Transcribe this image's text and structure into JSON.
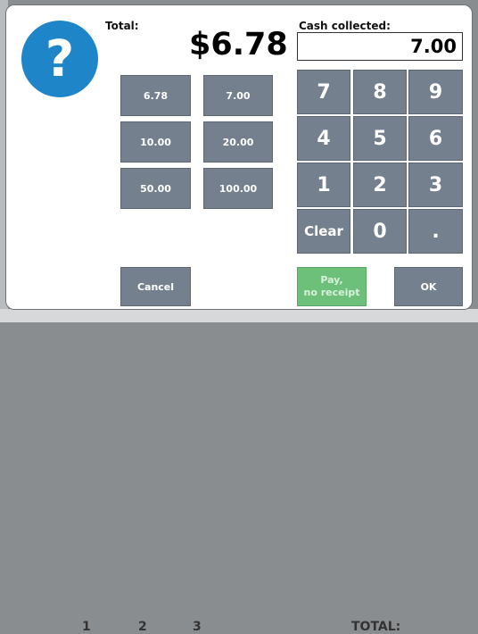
{
  "background": {
    "bottom_digits": [
      "1",
      "2",
      "3"
    ],
    "bottom_total_label": "TOTAL:"
  },
  "dialog": {
    "help_icon_glyph": "?",
    "total_label": "Total:",
    "total_value": "$6.78",
    "cash_label": "Cash collected:",
    "cash_value": "7.00"
  },
  "quick_amounts": [
    "6.78",
    "7.00",
    "10.00",
    "20.00",
    "50.00",
    "100.00"
  ],
  "keypad": {
    "keys": [
      "7",
      "8",
      "9",
      "4",
      "5",
      "6",
      "1",
      "2",
      "3",
      "Clear",
      "0",
      "."
    ]
  },
  "actions": {
    "cancel": "Cancel",
    "pay_no_receipt_line1": "Pay,",
    "pay_no_receipt_line2": "no receipt",
    "ok": "OK"
  },
  "colors": {
    "icon_blue": "#1e86c8",
    "button_gray": "#74808e",
    "pay_green": "#6cc07a"
  }
}
